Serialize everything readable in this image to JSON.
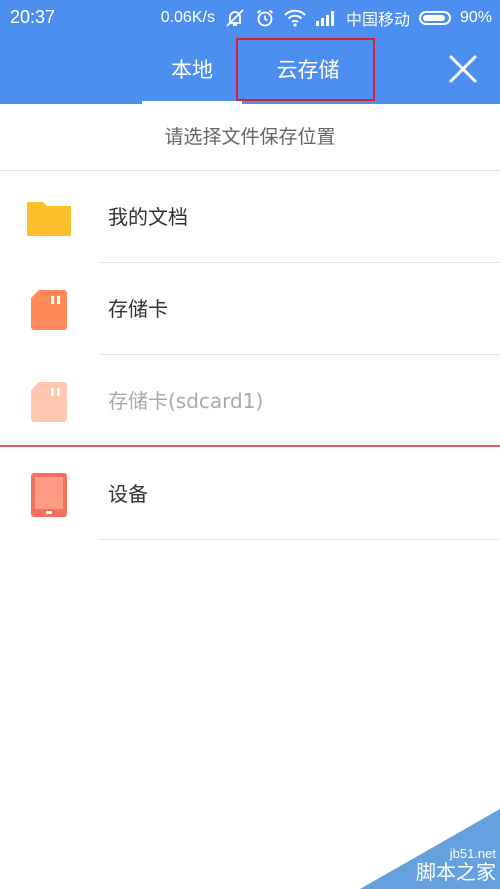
{
  "status_bar": {
    "time": "20:37",
    "net_speed": "0.06K/s",
    "carrier": "中国移动",
    "battery_percent": "90%",
    "battery_level": 0.9
  },
  "header": {
    "tabs": [
      {
        "label": "本地",
        "selected": true
      },
      {
        "label": "云存储",
        "selected": false
      }
    ],
    "close_icon": "close-icon",
    "color": "#4d8ff0"
  },
  "prompt": "请选择文件保存位置",
  "locations": [
    {
      "label": "我的文档",
      "icon": "folder-icon",
      "color": "#f9c02a",
      "enabled": true
    },
    {
      "label": "存储卡",
      "icon": "sd-card-icon",
      "color": "#ff8a59",
      "enabled": true
    },
    {
      "label": "存储卡(sdcard1)",
      "icon": "sd-card-icon",
      "color": "#ffc6b0",
      "enabled": false
    },
    {
      "label": "设备",
      "icon": "tablet-icon",
      "color": "#f0725c",
      "enabled": true
    }
  ],
  "watermark": {
    "url": "jb51.net",
    "name": "脚本之家"
  }
}
